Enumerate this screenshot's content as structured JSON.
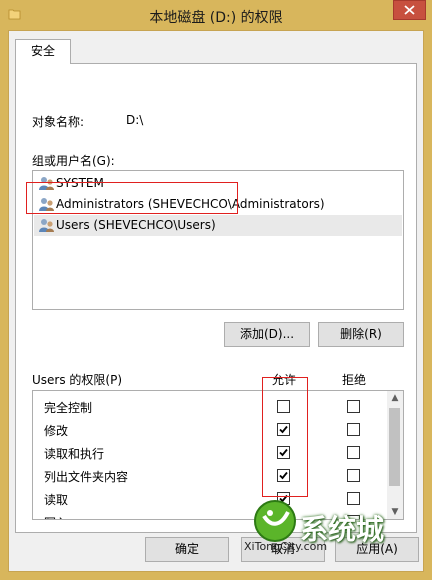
{
  "window": {
    "title": "本地磁盘 (D:) 的权限"
  },
  "tabs": [
    {
      "label": "安全"
    }
  ],
  "object": {
    "label": "对象名称:",
    "value": "D:\\"
  },
  "groups": {
    "label": "组或用户名(G):",
    "items": [
      {
        "label": "SYSTEM",
        "icon": "users-icon"
      },
      {
        "label": "Administrators (SHEVECHCO\\Administrators)",
        "icon": "users-icon"
      },
      {
        "label": "Users (SHEVECHCO\\Users)",
        "icon": "users-icon",
        "selected": true
      }
    ]
  },
  "actions": {
    "add_label": "添加(D)...",
    "remove_label": "删除(R)"
  },
  "permissions": {
    "label": "Users 的权限(P)",
    "allow_header": "允许",
    "deny_header": "拒绝",
    "rows": [
      {
        "name": "完全控制",
        "allow": false,
        "deny": false
      },
      {
        "name": "修改",
        "allow": true,
        "deny": false
      },
      {
        "name": "读取和执行",
        "allow": true,
        "deny": false
      },
      {
        "name": "列出文件夹内容",
        "allow": true,
        "deny": false
      },
      {
        "name": "读取",
        "allow": true,
        "deny": false
      },
      {
        "name": "写入",
        "allow": true,
        "deny": false
      }
    ]
  },
  "footer": {
    "ok_label": "确定",
    "cancel_label": "取消",
    "apply_label": "应用(A)"
  },
  "watermark": {
    "brand": "系统城",
    "url": "XiTongCity.com"
  },
  "colors": {
    "chrome": "#d8b65c",
    "close": "#c7503f",
    "highlight": "#e0201f",
    "selected_row": "#e9e9e9"
  }
}
